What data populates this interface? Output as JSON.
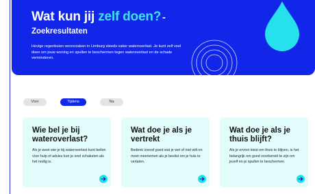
{
  "hero": {
    "title_main": "Wat kun jij",
    "title_accent": "zelf doen?",
    "title_dash": "-",
    "subtitle": "Zoekresultaten",
    "text": "Hevige regenbuien veroorzaken in Limburg steeds vaker wateroverlast. Je kunt zelf veel doen om jouw woning en spullen te beschermen tegen wateroverlast en de schade verminderen."
  },
  "tabs": [
    {
      "label": "Voor",
      "active": false
    },
    {
      "label": "Tijdens",
      "active": true
    },
    {
      "label": "Na",
      "active": false
    }
  ],
  "cards": [
    {
      "title": "Wie bel je bij wateroverlast?",
      "text": "Als je weet wie je bij wateroverlast kunt bellen voor hulp of advies kun je snel schakelen als het nodig is."
    },
    {
      "title": "Wat doe je als je vertrekt",
      "text": "Bedenk vooraf goed wat je wel of niet wilt en moet meenemen als je beslist om je huis te verlaten."
    },
    {
      "title": "Wat doe je als je thuis blijft?",
      "text": "Als je ervoor kiest om thuis te blijven, is het belangrijk om goed voorbereid te zijn om jezelf en je spullen te beschermen."
    }
  ],
  "colors": {
    "hero_bg": "#1126e8",
    "accent": "#3fe3f0",
    "card_bg": "#e2fbfb",
    "arrow": "#27e0ee"
  },
  "icons": {
    "drop": "water-drop-icon",
    "ripples": "ripple-circles-icon",
    "card_arrow": "arrow-right-icon"
  }
}
